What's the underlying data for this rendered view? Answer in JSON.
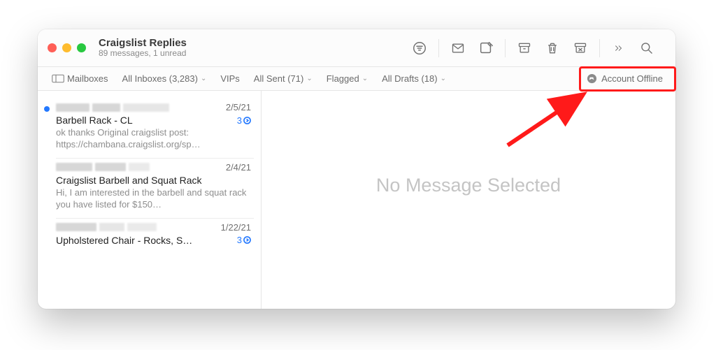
{
  "header": {
    "title": "Craigslist Replies",
    "subtitle": "89 messages, 1 unread"
  },
  "favorites": {
    "mailboxes": "Mailboxes",
    "allInboxes": "All Inboxes (3,283)",
    "vips": "VIPs",
    "allSent": "All Sent (71)",
    "flagged": "Flagged",
    "allDrafts": "All Drafts (18)"
  },
  "status": {
    "label": "Account Offline"
  },
  "messages": [
    {
      "date": "2/5/21",
      "subject": "Barbell Rack - CL",
      "preview": "ok thanks Original craigslist post: https://chambana.craigslist.org/sp…",
      "threadCount": "3",
      "unread": true
    },
    {
      "date": "2/4/21",
      "subject": "Craigslist Barbell and Squat Rack",
      "preview": "Hi, I am interested in the barbell and squat rack you have listed for $150…",
      "threadCount": "",
      "unread": false
    },
    {
      "date": "1/22/21",
      "subject": "Upholstered Chair - Rocks, S…",
      "preview": "",
      "threadCount": "3",
      "unread": false
    }
  ],
  "detail": {
    "empty": "No Message Selected"
  }
}
